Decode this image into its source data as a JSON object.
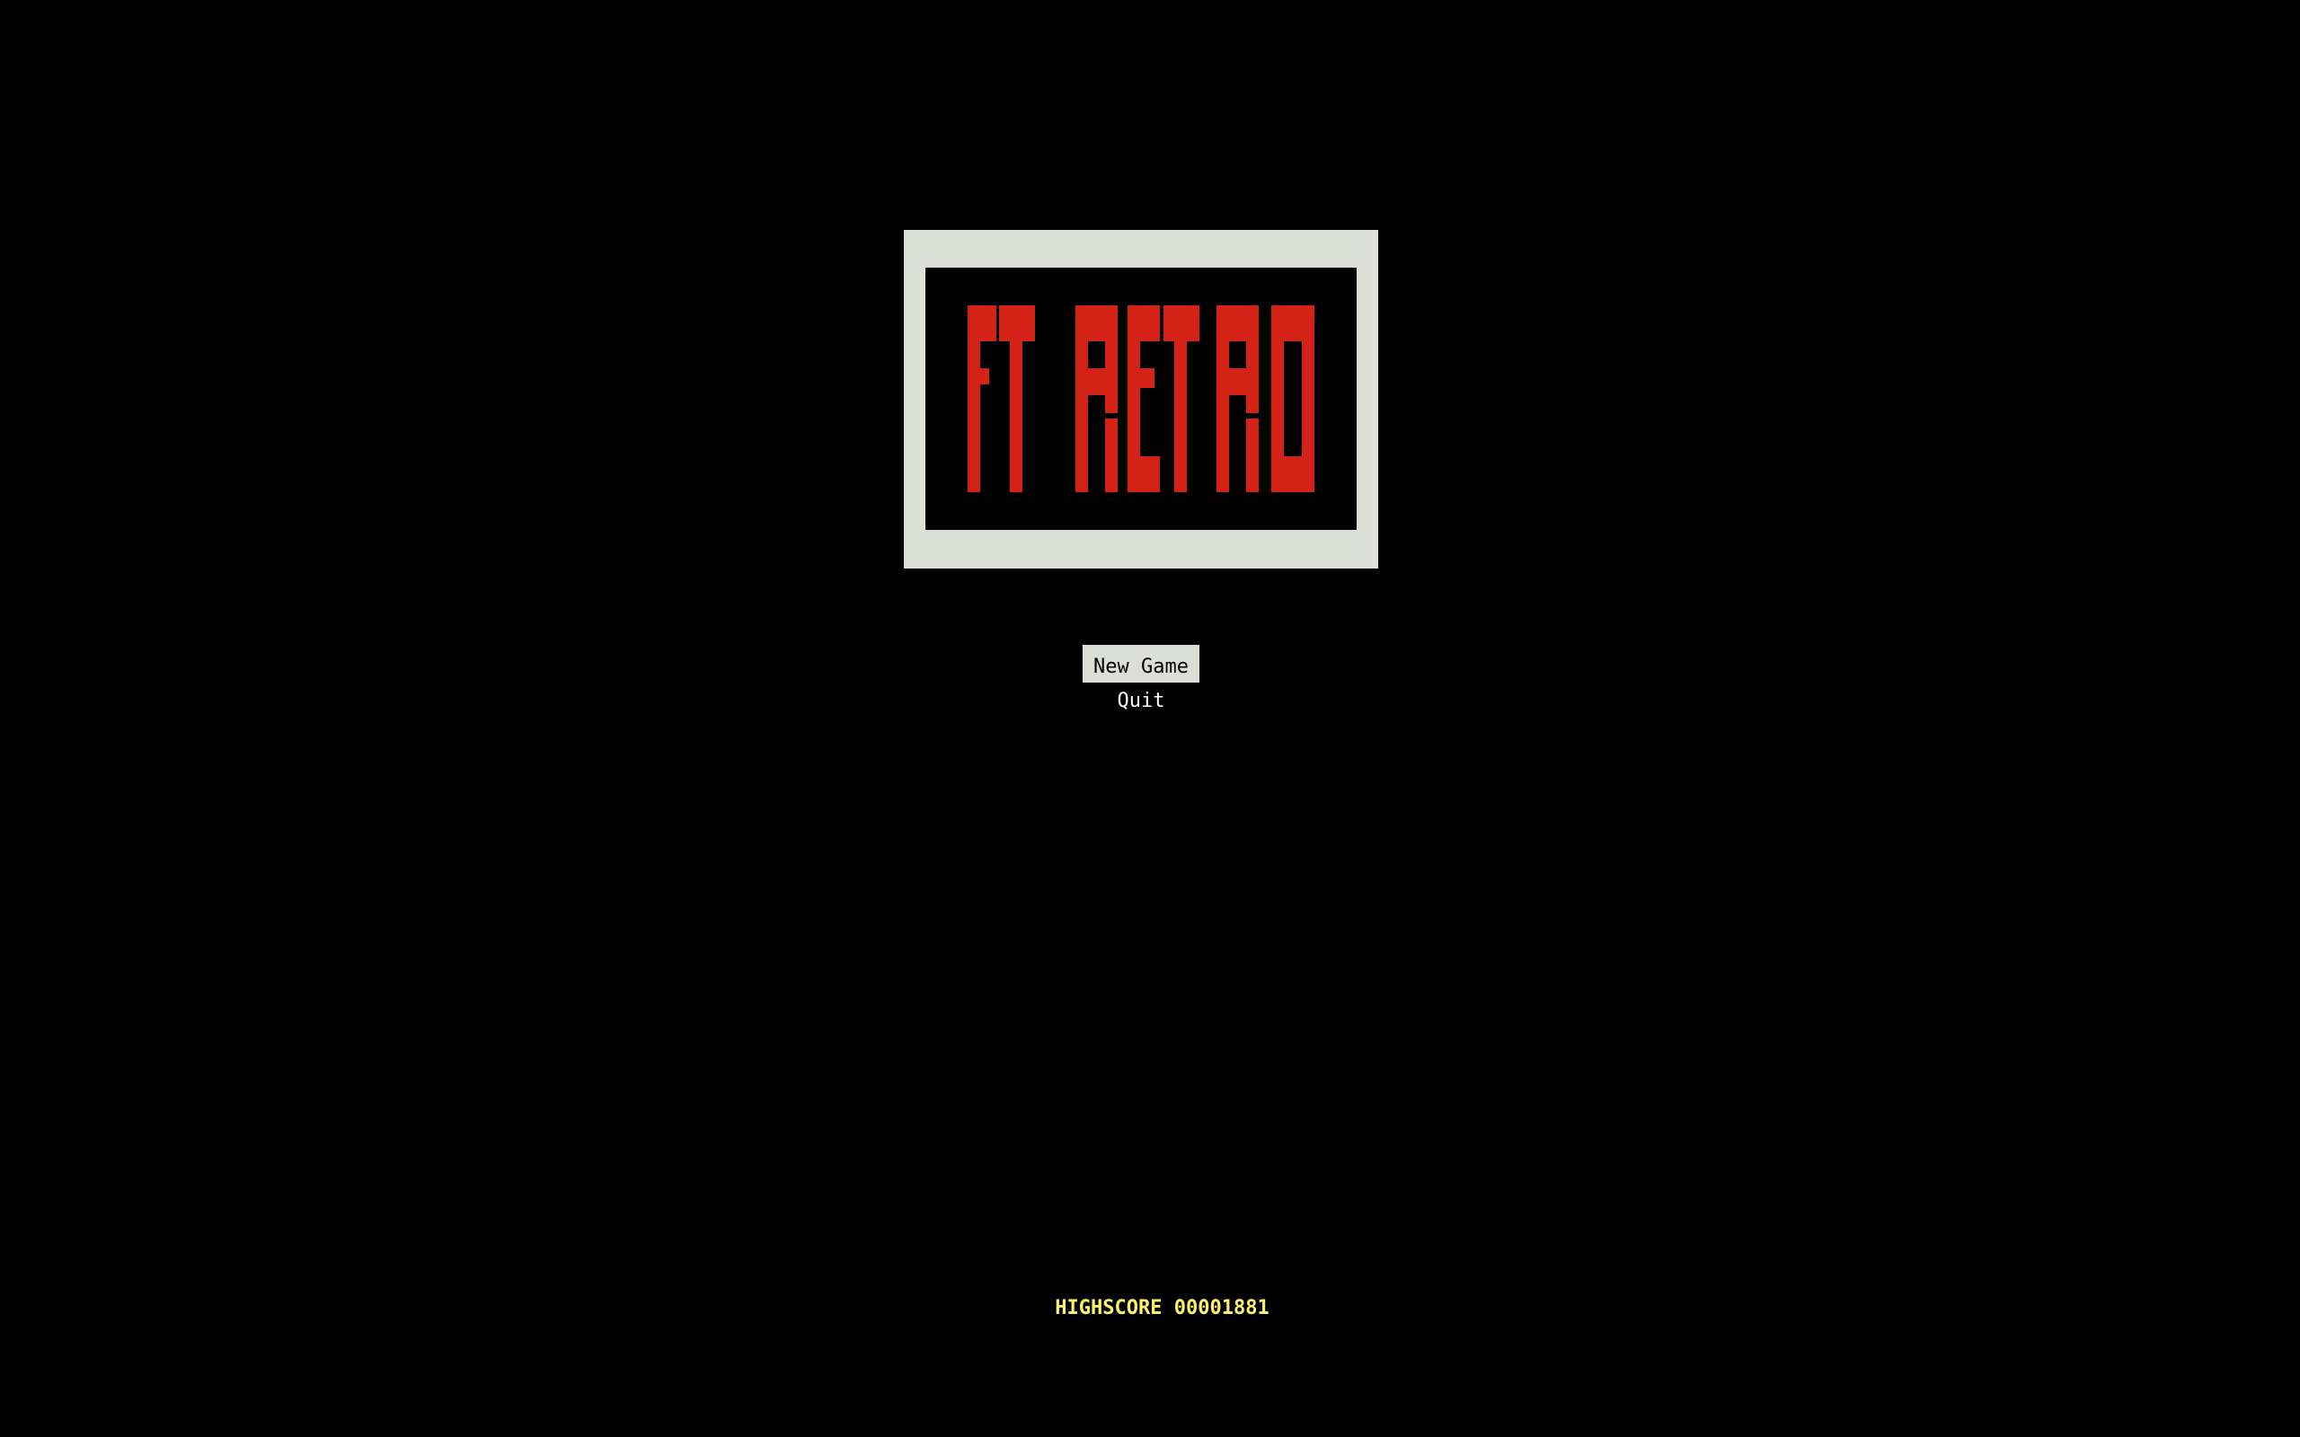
{
  "logo": {
    "text": "FT RETRO",
    "frame_color": "#dcdfd8",
    "glyph_color": "#d42216"
  },
  "menu": {
    "items": [
      {
        "label": "New Game",
        "selected": true
      },
      {
        "label": "Quit",
        "selected": false
      }
    ]
  },
  "highscore": {
    "label": "HIGHSCORE",
    "value": "00001881",
    "color": "#fff36b"
  }
}
